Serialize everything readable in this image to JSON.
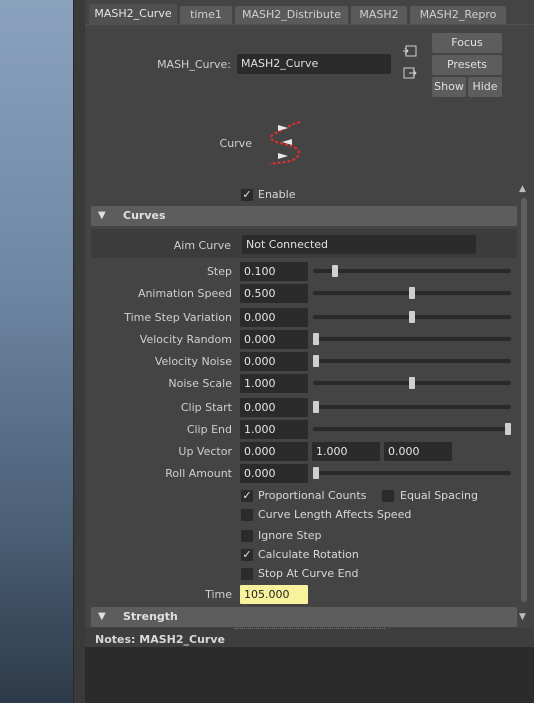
{
  "tabs": [
    {
      "label": "MASH2_Curve",
      "active": true
    },
    {
      "label": "time1",
      "active": false
    },
    {
      "label": "MASH2_Distribute",
      "active": false
    },
    {
      "label": "MASH2",
      "active": false
    },
    {
      "label": "MASH2_Repro",
      "active": false
    }
  ],
  "header": {
    "node_label": "MASH_Curve:",
    "node_value": "MASH2_Curve",
    "focus": "Focus",
    "presets": "Presets",
    "show": "Show",
    "hide": "Hide",
    "icon_label": "Curve",
    "input_icon": "input-connection-icon",
    "output_icon": "output-connection-icon",
    "curve_icon": "mash-curve-node-icon"
  },
  "enable": {
    "label": "Enable",
    "checked": true
  },
  "curves": {
    "title": "Curves",
    "aim_curve_label": "Aim Curve",
    "aim_curve_value": "Not Connected",
    "fields": {
      "step": {
        "label": "Step",
        "value": "0.100",
        "slider": 0.1
      },
      "animation_speed": {
        "label": "Animation Speed",
        "value": "0.500",
        "slider": 0.5
      },
      "time_step_variation": {
        "label": "Time Step Variation",
        "value": "0.000",
        "slider": 0.5
      },
      "velocity_random": {
        "label": "Velocity Random",
        "value": "0.000",
        "slider": 0.0
      },
      "velocity_noise": {
        "label": "Velocity Noise",
        "value": "0.000",
        "slider": 0.0
      },
      "noise_scale": {
        "label": "Noise Scale",
        "value": "1.000",
        "slider": 0.5
      },
      "clip_start": {
        "label": "Clip Start",
        "value": "0.000",
        "slider": 0.0
      },
      "clip_end": {
        "label": "Clip End",
        "value": "1.000",
        "slider": 1.0
      },
      "roll_amount": {
        "label": "Roll Amount",
        "value": "0.000",
        "slider": 0.0
      }
    },
    "up_vector": {
      "label": "Up Vector",
      "x": "0.000",
      "y": "1.000",
      "z": "0.000"
    },
    "checkboxes": {
      "proportional_counts": {
        "label": "Proportional Counts",
        "checked": true
      },
      "equal_spacing": {
        "label": "Equal Spacing",
        "checked": false
      },
      "curve_length": {
        "label": "Curve Length Affects Speed",
        "checked": false
      },
      "ignore_step": {
        "label": "Ignore Step",
        "checked": false
      },
      "calculate_rotation": {
        "label": "Calculate Rotation",
        "checked": true
      },
      "stop_at_curve_end": {
        "label": "Stop At Curve End",
        "checked": false
      }
    },
    "time": {
      "label": "Time",
      "value": "105.000",
      "highlight": "#f7f29b"
    }
  },
  "strength": {
    "title": "Strength"
  },
  "notes": {
    "label": "Notes:  MASH2_Curve"
  },
  "colors": {
    "panel": "#444444",
    "field": "#2b2b2b",
    "section": "#5d5d5d",
    "curve_icon": "#e03030"
  }
}
